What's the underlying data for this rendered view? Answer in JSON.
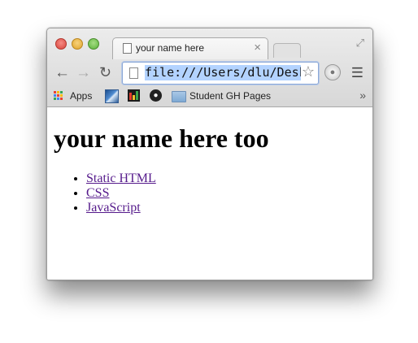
{
  "browser": {
    "tab_title": "your name here",
    "tab_close": "×",
    "url": "file:///Users/dlu/Desktop/i",
    "bookmarks": {
      "apps_label": "Apps",
      "folder_label": "Student GH Pages",
      "more": "»"
    }
  },
  "page": {
    "heading": "your name here too",
    "links": [
      {
        "label": "Static HTML"
      },
      {
        "label": "CSS"
      },
      {
        "label": "JavaScript"
      }
    ],
    "link_color": "#551a8b"
  },
  "colors": {
    "close": "#e0463e",
    "minimize": "#e2a52b",
    "maximize": "#5cb33b",
    "url_highlight": "#b3d3ff"
  },
  "icons": [
    "document-icon",
    "star-icon",
    "apps-grid-icon",
    "github-icon",
    "folder-icon",
    "menu-icon"
  ]
}
